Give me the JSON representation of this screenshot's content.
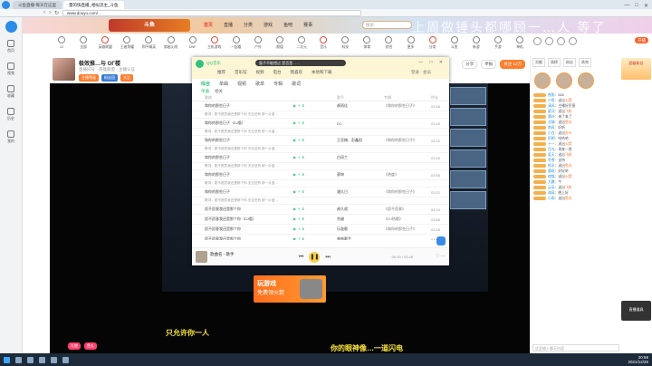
{
  "browser": {
    "tabs": [
      "斗鱼直播-每天在这里",
      "量的快直播_相似流主_斗鱼"
    ],
    "url": "www.douyu.com/...",
    "controls": [
      "—",
      "□",
      "✕"
    ]
  },
  "left_rail": {
    "items": [
      "首页",
      "视频",
      "收藏",
      "历史",
      "我的"
    ]
  },
  "site": {
    "logo": "斗鱼",
    "nav": [
      "首页",
      "直播",
      "分类",
      "游戏",
      "鱼吧",
      "赛事"
    ],
    "nav_active": 1,
    "search_placeholder": "搜索",
    "banner_text": "上周做锤头都哪顾一…人 等了"
  },
  "categories": [
    "12",
    "全部",
    "英雄联盟",
    "王者荣耀",
    "和平精英",
    "穿越火线",
    "DNF",
    "主机游戏",
    "一起看",
    "户外",
    "颜值",
    "二次元",
    "音乐",
    "科技",
    "体育",
    "综合",
    "更多",
    "分类",
    "斗鱼",
    "新游",
    "手游",
    "单机"
  ],
  "right_strip": {
    "button": "开播"
  },
  "room": {
    "title": "极效推…与 ΟΓ楼",
    "meta": "直播间号 · 英雄联盟 · 主播认证",
    "tags": [
      "主播等级",
      "粉丝团",
      "关注"
    ],
    "actions": [
      "分享",
      "举报",
      "关注 12万"
    ]
  },
  "music": {
    "brand": "QQ音乐",
    "search": "量子不能错过 是否是……",
    "icons": [
      "推荐",
      "音乐馆",
      "视频",
      "电台",
      "我喜欢",
      "本地和下载"
    ],
    "user": "登录 · 会员",
    "win_ctrl": "— □ ✕",
    "tabs": [
      "综合",
      "单曲",
      "视频",
      "歌单",
      "专辑",
      "歌词"
    ],
    "tabs_active": 0,
    "subtabs": [
      "单曲",
      "相关"
    ],
    "columns": [
      "歌曲",
      "歌手",
      "专辑",
      "时长"
    ],
    "songs": [
      {
        "title": "和你的那些日子",
        "artist": "郝雨佳",
        "album": "《和你的那些日子》",
        "dur": "03:48"
      },
      {
        "title": "和你的那些日子（DJ版）",
        "artist": "DJ",
        "album": "",
        "dur": "03:20"
      },
      {
        "title": "和你的那些日子",
        "artist": "王亚楠、彭鑫阳",
        "album": "《和你的那些日子》",
        "dur": "04:02"
      },
      {
        "title": "和你的那些日子",
        "artist": "白凤兰",
        "album": "",
        "dur": "03:45"
      },
      {
        "title": "和你的那些日子",
        "artist": "蔡坤",
        "album": "《热度》",
        "dur": "03:55"
      },
      {
        "title": "和你的那些日子",
        "artist": "潘久日",
        "album": "《和你的那些日子》",
        "dur": "03:21"
      },
      {
        "title": "愿不愿意我还是那个你",
        "artist": "郝久斌",
        "album": "《愿不愿意》",
        "dur": "04:10"
      },
      {
        "title": "愿不愿意我还是那个你（DJ版）",
        "artist": "余越",
        "album": "《DJ热歌》",
        "dur": "03:58"
      },
      {
        "title": "愿不愿意我还是那个你",
        "artist": "乐鼓歌",
        "album": "《和你的那些日子》",
        "dur": "03:35"
      },
      {
        "title": "愿不愿意我还是那个你",
        "artist": "单曲歌手",
        "album": "",
        "dur": "04:05"
      }
    ],
    "sub_line": "歌词：愿不愿意我还是那个你 天空还有 那一片蓝…",
    "player": {
      "name": "歌曲名 - 歌手",
      "time": "00:00 / 03:48",
      "play": "❚❚",
      "prev": "⏮",
      "next": "⏭",
      "right": "♡ ⋯"
    }
  },
  "video": {
    "caption_left": "只允许你一人",
    "caption_right": "你的眼神像…一道闪电",
    "ad_title": "玩游戏",
    "ad_sub": "免费领火箭",
    "bottom_pills": [
      "礼物",
      "鱼丸"
    ]
  },
  "side": {
    "tabs": [
      "贡献",
      "周榜",
      "粉丝",
      "贵宾"
    ],
    "chat": [
      {
        "name": "夜雨",
        "text": "666",
        "gift": ""
      },
      {
        "name": "小鱼",
        "text": "送出",
        "gift": "火箭"
      },
      {
        "name": "清风",
        "text": "主播好厉害",
        "gift": ""
      },
      {
        "name": "星河",
        "text": "送出",
        "gift": "飞机"
      },
      {
        "name": "落叶",
        "text": "来了来了",
        "gift": ""
      },
      {
        "name": "北城",
        "text": "送出",
        "gift": "鱼丸"
      },
      {
        "name": "南风",
        "text": "好听",
        "gift": ""
      },
      {
        "name": "小白",
        "text": "送出",
        "gift": "办卡"
      },
      {
        "name": "阿明",
        "text": "哈哈哈",
        "gift": ""
      },
      {
        "name": "十一",
        "text": "送出",
        "gift": "火箭"
      },
      {
        "name": "月光",
        "text": "再来一首",
        "gift": ""
      },
      {
        "name": "夏天",
        "text": "送出",
        "gift": "飞机"
      },
      {
        "name": "冬雪",
        "text": "支持",
        "gift": ""
      },
      {
        "name": "秋水",
        "text": "送出",
        "gift": "鱼丸"
      },
      {
        "name": "晨曦",
        "text": "好好听",
        "gift": ""
      },
      {
        "name": "夜猫",
        "text": "送出",
        "gift": "火箭"
      },
      {
        "name": "大鹏",
        "text": "牛",
        "gift": ""
      },
      {
        "name": "云朵",
        "text": "送出",
        "gift": "飞机"
      },
      {
        "name": "海风",
        "text": "晚上好",
        "gift": ""
      },
      {
        "name": "小雨",
        "text": "送出",
        "gift": "鱼丸"
      }
    ],
    "input_placeholder": "这里输入聊天内容"
  },
  "far_right": {
    "ad": "超级粉丝",
    "bottom": "直播道具"
  },
  "taskbar": {
    "time": "20:58",
    "date": "2021/12/26"
  }
}
